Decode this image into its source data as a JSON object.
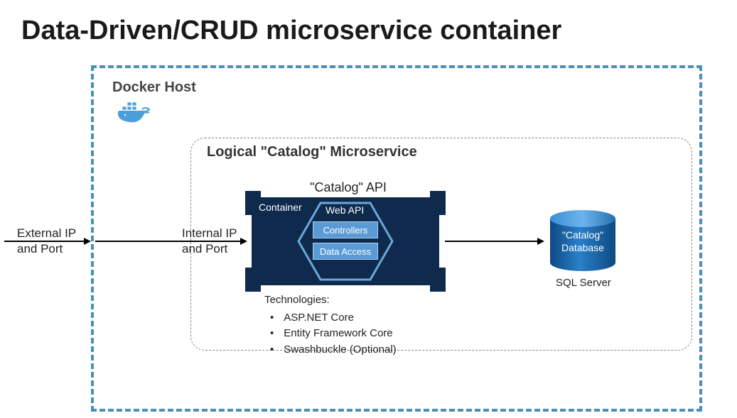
{
  "title": "Data-Driven/CRUD microservice container",
  "dockerHost": {
    "label": "Docker Host"
  },
  "logicalMs": {
    "label": "Logical \"Catalog\" Microservice"
  },
  "externalLabel": {
    "line1": "External IP",
    "line2": "and Port"
  },
  "internalLabel": {
    "line1": "Internal IP",
    "line2": "and Port"
  },
  "apiLabel": "\"Catalog\" API",
  "container": {
    "label": "Container",
    "webApiLabel": "Web API",
    "controllers": "Controllers",
    "dataAccess": "Data Access"
  },
  "technologies": {
    "heading": "Technologies:",
    "items": [
      "ASP.NET Core",
      "Entity Framework Core",
      "Swashbuckle (Optional)"
    ]
  },
  "database": {
    "line1": "\"Catalog\"",
    "line2": "Database",
    "engine": "SQL Server"
  },
  "colors": {
    "dashedBorder": "#4a8fb8",
    "containerNavy": "#0f2a4d",
    "innerBlue": "#5b9bd5",
    "dbBlue": "#1e6bb8"
  }
}
